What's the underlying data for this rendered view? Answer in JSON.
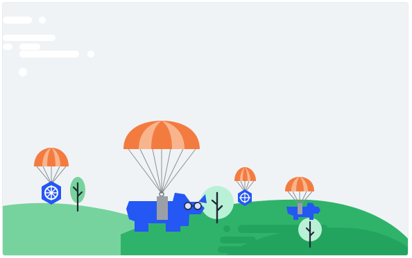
{
  "scene": {
    "background_color": "#f0f3f5",
    "hill_light_color": "#77d39d",
    "hill_mid_color": "#2fb36a",
    "hill_dark_color": "#23a45e",
    "canopy_orange": "#f47b3f",
    "canopy_peach": "#f8b58d",
    "cargo_blue": "#2457f3",
    "tree_mint": "#b9f1d7",
    "tree_trunk": "#1f2933",
    "cloud_color": "#ffffff"
  },
  "icons": {
    "main_cargo": "blue-bull-mascot-icon",
    "small_cargo": "kubernetes-helm-icon",
    "parachute": "parachute-icon",
    "tree": "tree-icon",
    "cloud": "cloud-streak-icon"
  }
}
